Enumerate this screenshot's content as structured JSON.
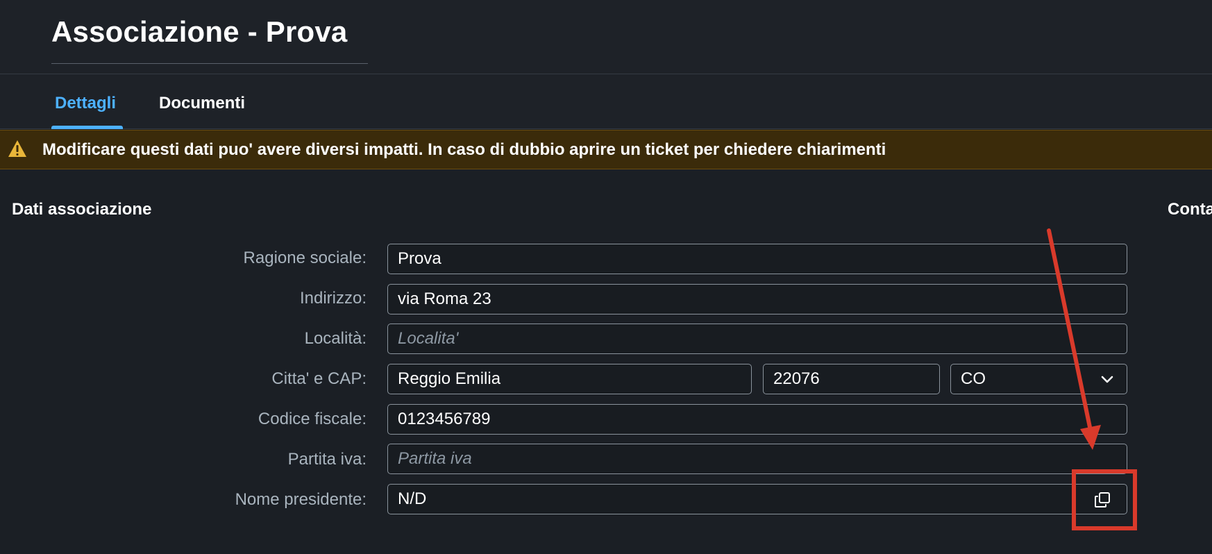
{
  "header": {
    "title": "Associazione - Prova"
  },
  "tabs": [
    {
      "label": "Dettagli",
      "active": true
    },
    {
      "label": "Documenti",
      "active": false
    }
  ],
  "warning": {
    "icon": "warning-triangle-icon",
    "text": "Modificare questi dati puo' avere diversi impatti. In caso di dubbio aprire un ticket per chiedere chiarimenti"
  },
  "sections": {
    "left_title": "Dati associazione",
    "right_title_partial": "Conta"
  },
  "form": {
    "ragione_sociale": {
      "label": "Ragione sociale:",
      "value": "Prova"
    },
    "indirizzo": {
      "label": "Indirizzo:",
      "value": "via Roma 23"
    },
    "localita": {
      "label": "Località:",
      "value": "",
      "placeholder": "Localita'"
    },
    "citta_cap": {
      "label": "Citta' e CAP:",
      "citta": "Reggio Emilia",
      "cap": "22076",
      "provincia": "CO"
    },
    "codice_fiscale": {
      "label": "Codice fiscale:",
      "value": "0123456789"
    },
    "partita_iva": {
      "label": "Partita iva:",
      "value": "",
      "placeholder": "Partita iva"
    },
    "nome_presidente": {
      "label": "Nome presidente:",
      "value": "N/D",
      "action_icon": "copy-icon"
    }
  },
  "colors": {
    "accent": "#4db1ff",
    "warning_bg": "#3b2b0a",
    "annotation": "#d93a2b"
  }
}
